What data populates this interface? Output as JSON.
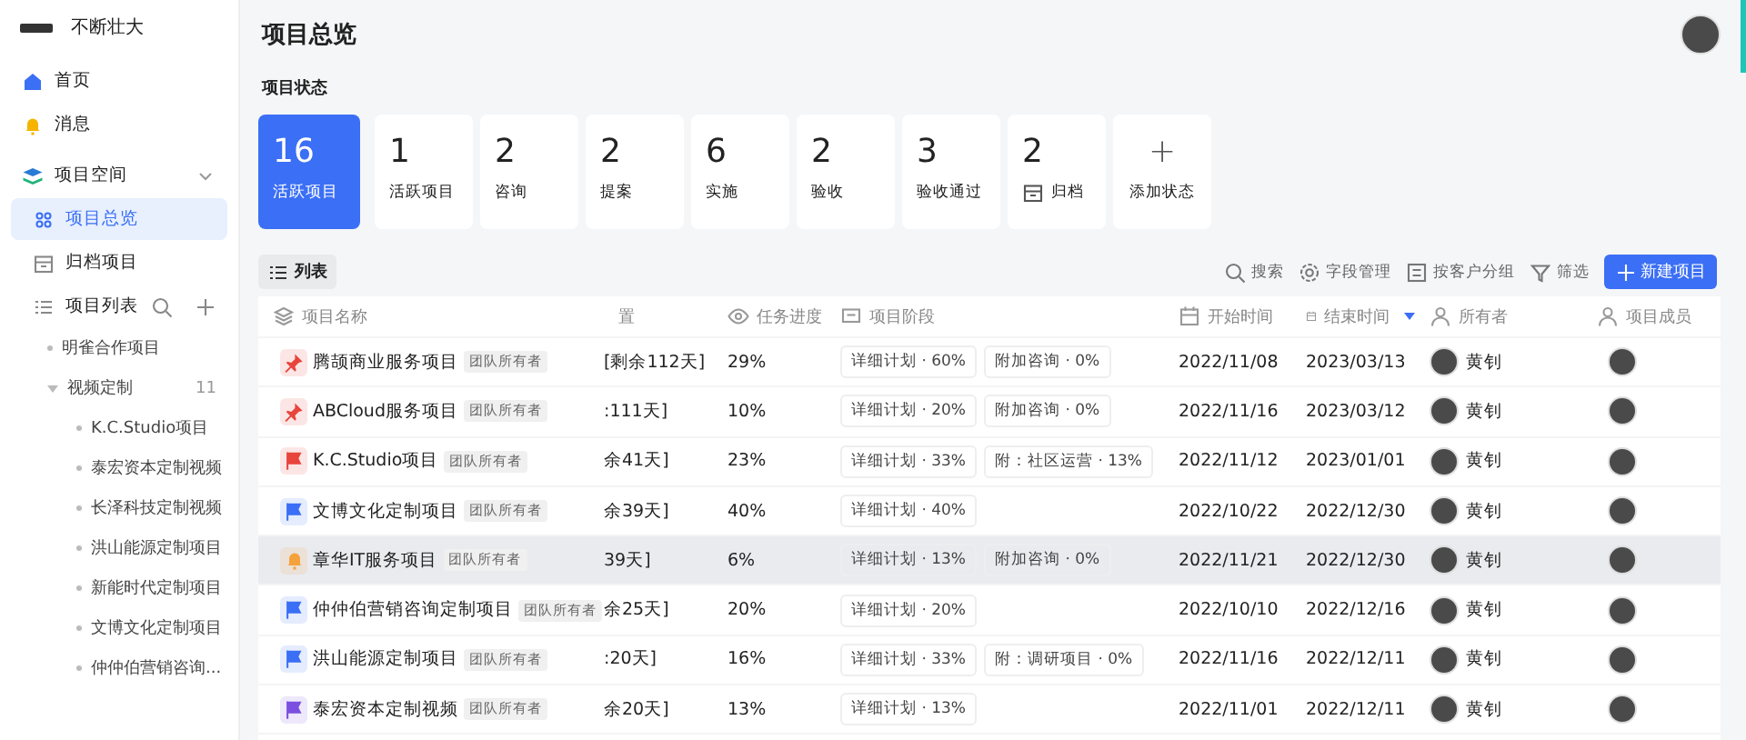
{
  "sidebar": {
    "brand": "不断壮大",
    "nav": [
      {
        "label": "首页",
        "kind": "home"
      },
      {
        "label": "消息",
        "kind": "bell"
      }
    ],
    "space": {
      "label": "项目空间",
      "expanded": true,
      "items": [
        {
          "label": "项目总览",
          "kind": "overview",
          "selected": true
        },
        {
          "label": "归档项目",
          "kind": "archive",
          "selected": false
        }
      ]
    },
    "project_list": {
      "label": "项目列表",
      "tree": [
        {
          "label": "明雀合作项目",
          "expanded": false
        },
        {
          "label": "视频定制",
          "count": "11",
          "expanded": true,
          "children": [
            {
              "label": "K.C.Studio项目"
            },
            {
              "label": "泰宏资本定制视频"
            },
            {
              "label": "长泽科技定制视频"
            },
            {
              "label": "洪山能源定制项目"
            },
            {
              "label": "新能时代定制项目"
            },
            {
              "label": "文博文化定制项目"
            },
            {
              "label": "仲仲伯营销咨询..."
            }
          ]
        }
      ]
    }
  },
  "header": {
    "title": "项目总览"
  },
  "status": {
    "title": "项目状态",
    "cards": [
      {
        "kind": "count",
        "count": "16",
        "label": "活跃项目",
        "selected": true
      },
      {
        "kind": "count",
        "count": "1",
        "label": "活跃项目",
        "selected": false
      },
      {
        "kind": "count",
        "count": "2",
        "label": "咨询",
        "selected": false
      },
      {
        "kind": "count",
        "count": "2",
        "label": "提案",
        "selected": false
      },
      {
        "kind": "count",
        "count": "6",
        "label": "实施",
        "selected": false
      },
      {
        "kind": "count",
        "count": "2",
        "label": "验收",
        "selected": false
      },
      {
        "kind": "count",
        "count": "3",
        "label": "验收通过",
        "selected": false
      },
      {
        "kind": "archive",
        "count": "2",
        "label": "归档",
        "selected": false
      },
      {
        "kind": "add",
        "count": "+",
        "label": "添加状态",
        "selected": false
      }
    ]
  },
  "toolbar": {
    "view": "列表",
    "actions": [
      {
        "label": "搜索",
        "kind": "search"
      },
      {
        "label": "字段管理",
        "kind": "gear"
      },
      {
        "label": "按客户分组",
        "kind": "group"
      },
      {
        "label": "筛选",
        "kind": "filter"
      }
    ],
    "primary": "新建项目"
  },
  "table": {
    "columns": [
      {
        "label": "项目名称",
        "kind": "layers",
        "sorted": false
      },
      {
        "label": "置",
        "kind": "none",
        "sorted": false
      },
      {
        "label": "任务进度",
        "kind": "eye",
        "sorted": false
      },
      {
        "label": "项目阶段",
        "kind": "chat",
        "sorted": false
      },
      {
        "label": "开始时间",
        "kind": "calendar",
        "sorted": false
      },
      {
        "label": "结束时间",
        "kind": "calendar",
        "sorted": true
      },
      {
        "label": "所有者",
        "kind": "user",
        "sorted": false
      },
      {
        "label": "项目成员",
        "kind": "user",
        "sorted": false
      }
    ],
    "rows": [
      {
        "kind": "pin",
        "color": "#e8453c",
        "name": "腾颉商业服务项目",
        "tag": "团队所有者",
        "column_2": "[剩余112天]",
        "progress": "29%",
        "stages": [
          "详细计划 · 60%",
          "附加咨询 · 0%"
        ],
        "start": "2022/11/08",
        "end": "2023/03/13",
        "owner": "黄钊",
        "hovered": false
      },
      {
        "kind": "pin",
        "color": "#e8453c",
        "name": "ABCloud服务项目",
        "tag": "团队所有者",
        "column_2": ":111天]",
        "progress": "10%",
        "stages": [
          "详细计划 · 20%",
          "附加咨询 · 0%"
        ],
        "start": "2022/11/16",
        "end": "2023/03/12",
        "owner": "黄钊",
        "hovered": false
      },
      {
        "kind": "flag",
        "color": "#e8453c",
        "name": "K.C.Studio项目",
        "tag": "团队所有者",
        "column_2": "余41天]",
        "progress": "23%",
        "stages": [
          "详细计划 · 33%",
          "附：社区运营 · 13%"
        ],
        "start": "2022/11/12",
        "end": "2023/01/01",
        "owner": "黄钊",
        "hovered": false
      },
      {
        "kind": "flag",
        "color": "#3b6ff5",
        "name": "文博文化定制项目",
        "tag": "团队所有者",
        "column_2": "余39天]",
        "progress": "40%",
        "stages": [
          "详细计划 · 40%"
        ],
        "start": "2022/10/22",
        "end": "2022/12/30",
        "owner": "黄钊",
        "hovered": false
      },
      {
        "kind": "bell",
        "color": "#f5a23c",
        "name": "章华IT服务项目",
        "tag": "团队所有者",
        "column_2": "39天]",
        "progress": "6%",
        "stages": [
          "详细计划 · 13%",
          "附加咨询 · 0%"
        ],
        "start": "2022/11/21",
        "end": "2022/12/30",
        "owner": "黄钊",
        "hovered": true
      },
      {
        "kind": "flag",
        "color": "#3b6ff5",
        "name": "仲仲伯营销咨询定制项目",
        "tag": "团队所有者",
        "column_2": "余25天]",
        "progress": "20%",
        "stages": [
          "详细计划 · 20%"
        ],
        "start": "2022/10/10",
        "end": "2022/12/16",
        "owner": "黄钊",
        "hovered": false
      },
      {
        "kind": "flag",
        "color": "#3b6ff5",
        "name": "洪山能源定制项目",
        "tag": "团队所有者",
        "column_2": ":20天]",
        "progress": "16%",
        "stages": [
          "详细计划 · 33%",
          "附：调研项目 · 0%"
        ],
        "start": "2022/11/16",
        "end": "2022/12/11",
        "owner": "黄钊",
        "hovered": false
      },
      {
        "kind": "flag",
        "color": "#7b4fe0",
        "name": "泰宏资本定制视频",
        "tag": "团队所有者",
        "column_2": "余20天]",
        "progress": "13%",
        "stages": [
          "详细计划 · 13%"
        ],
        "start": "2022/11/01",
        "end": "2022/12/11",
        "owner": "黄钊",
        "hovered": false
      }
    ]
  }
}
